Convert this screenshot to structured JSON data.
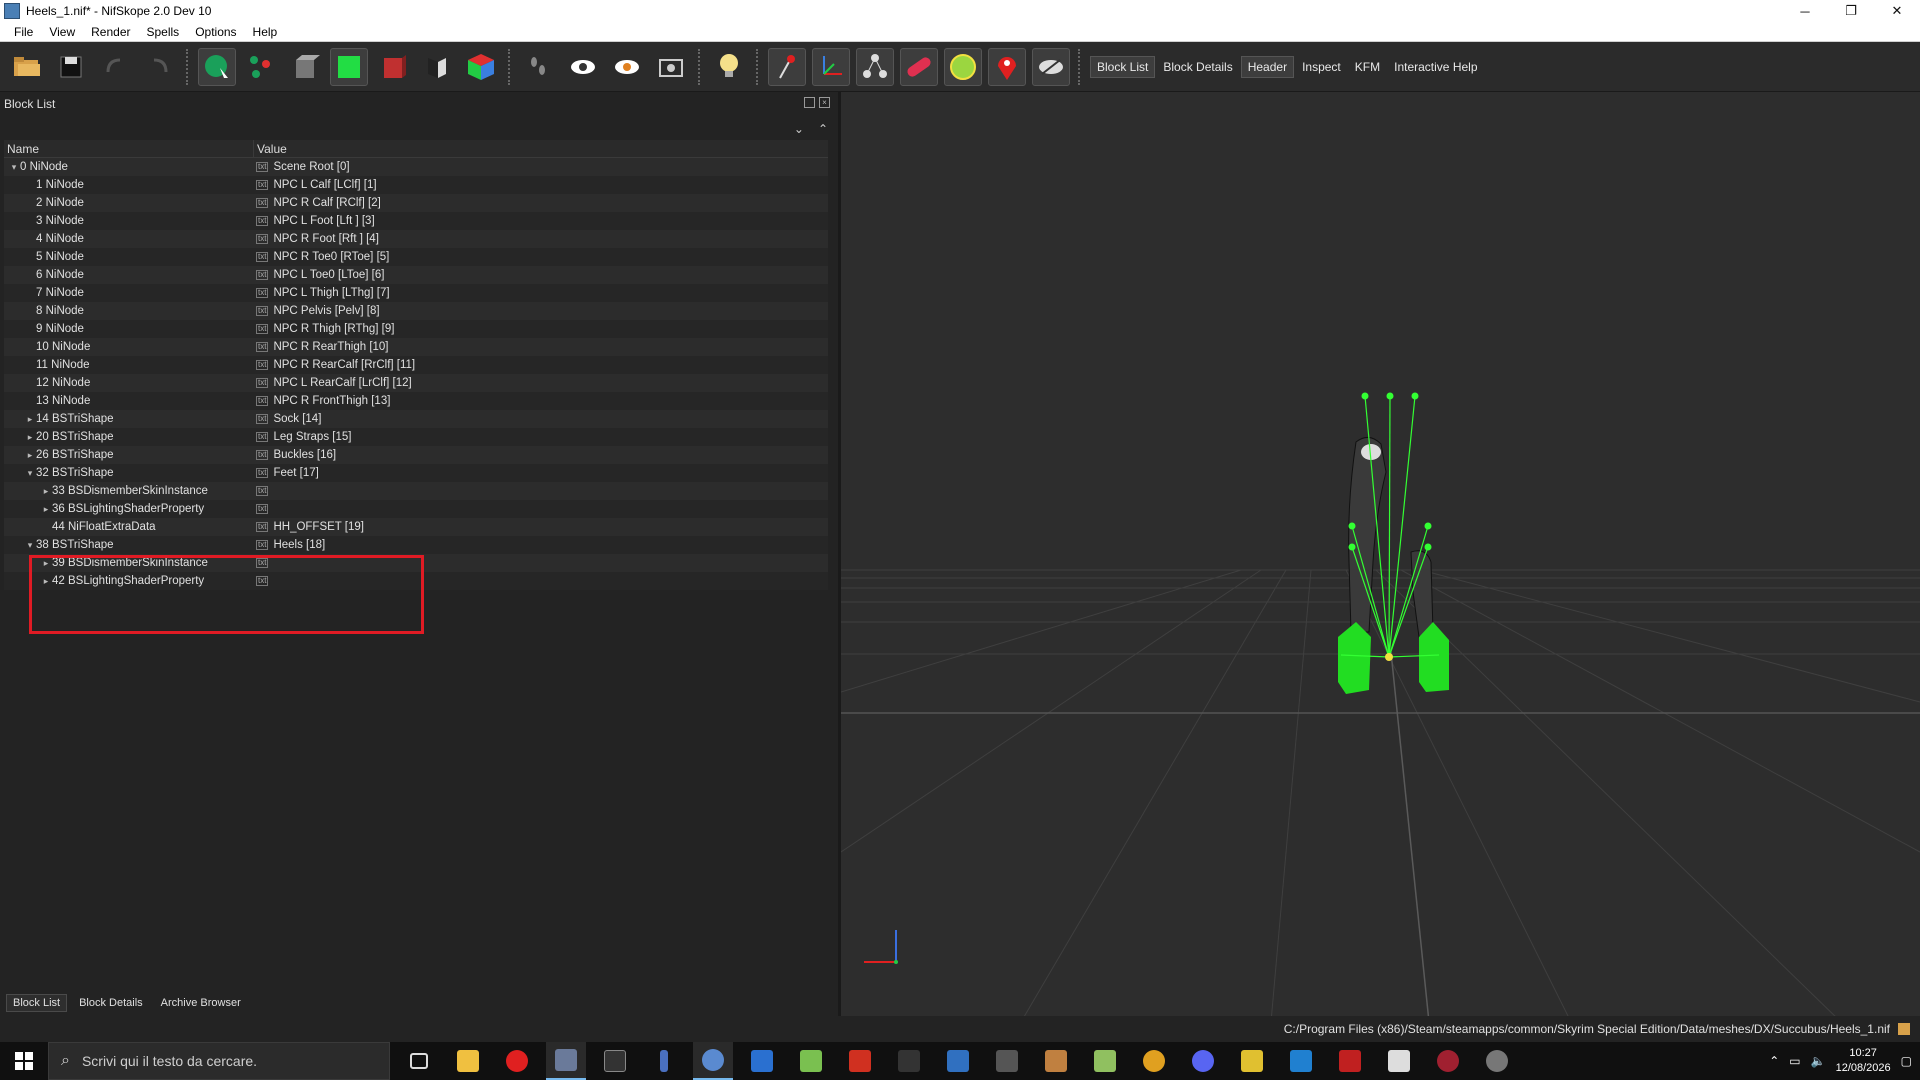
{
  "window": {
    "title": "Heels_1.nif* - NifSkope 2.0 Dev 10",
    "minimize": "─",
    "restore": "❐",
    "close": "✕"
  },
  "menu": [
    "File",
    "View",
    "Render",
    "Spells",
    "Options",
    "Help"
  ],
  "toolbar": {
    "text_buttons": [
      "Block List",
      "Block Details",
      "Header",
      "Inspect",
      "KFM",
      "Interactive Help"
    ]
  },
  "block_list": {
    "title": "Block List",
    "expand_all": "⌄",
    "collapse_all": "⌃",
    "columns": {
      "name": "Name",
      "value": "Value"
    },
    "value_icon": "txt",
    "rows": [
      {
        "arrow": "▾",
        "name": "0 NiNode",
        "value": "Scene Root [0]"
      },
      {
        "arrow": "",
        "name": "1 NiNode",
        "value": "NPC L Calf [LClf] [1]"
      },
      {
        "arrow": "",
        "name": "2 NiNode",
        "value": "NPC R Calf [RClf] [2]"
      },
      {
        "arrow": "",
        "name": "3 NiNode",
        "value": "NPC L Foot [Lft ] [3]"
      },
      {
        "arrow": "",
        "name": "4 NiNode",
        "value": "NPC R Foot [Rft ] [4]"
      },
      {
        "arrow": "",
        "name": "5 NiNode",
        "value": "NPC R Toe0 [RToe] [5]"
      },
      {
        "arrow": "",
        "name": "6 NiNode",
        "value": "NPC L Toe0 [LToe] [6]"
      },
      {
        "arrow": "",
        "name": "7 NiNode",
        "value": "NPC L Thigh [LThg] [7]"
      },
      {
        "arrow": "",
        "name": "8 NiNode",
        "value": "NPC Pelvis [Pelv] [8]"
      },
      {
        "arrow": "",
        "name": "9 NiNode",
        "value": "NPC R Thigh [RThg] [9]"
      },
      {
        "arrow": "",
        "name": "10 NiNode",
        "value": "NPC R RearThigh [10]"
      },
      {
        "arrow": "",
        "name": "11 NiNode",
        "value": "NPC R RearCalf [RrClf] [11]"
      },
      {
        "arrow": "",
        "name": "12 NiNode",
        "value": "NPC L RearCalf [LrClf] [12]"
      },
      {
        "arrow": "",
        "name": "13 NiNode",
        "value": "NPC R FrontThigh [13]"
      },
      {
        "arrow": "▸",
        "name": "14 BSTriShape",
        "value": "Sock [14]"
      },
      {
        "arrow": "▸",
        "name": "20 BSTriShape",
        "value": "Leg Straps [15]"
      },
      {
        "arrow": "▸",
        "name": "26 BSTriShape",
        "value": "Buckles [16]"
      },
      {
        "arrow": "▾",
        "name": "32 BSTriShape",
        "value": "Feet [17]"
      },
      {
        "arrow": "▸",
        "name": "33 BSDismemberSkinInstance",
        "value": ""
      },
      {
        "arrow": "▸",
        "name": "36 BSLightingShaderProperty",
        "value": ""
      },
      {
        "arrow": "",
        "name": "44 NiFloatExtraData",
        "value": "HH_OFFSET [19]"
      },
      {
        "arrow": "▾",
        "name": "38 BSTriShape",
        "value": "Heels [18]"
      },
      {
        "arrow": "▸",
        "name": "39 BSDismemberSkinInstance",
        "value": ""
      },
      {
        "arrow": "▸",
        "name": "42 BSLightingShaderProperty",
        "value": ""
      }
    ]
  },
  "bottom_tabs": [
    "Block List",
    "Block Details",
    "Archive Browser"
  ],
  "status_path": "C:/Program Files (x86)/Steam/steamapps/common/Skyrim Special Edition/Data/meshes/DX/Succubus/Heels_1.nif",
  "taskbar": {
    "search_placeholder": "Scrivi qui il testo da cercare.",
    "time": "10:27",
    "date": "12/08/2026"
  },
  "colors": {
    "highlight": "#e01b24",
    "skeleton": "#33ff33",
    "mesh": "#22dd22"
  }
}
